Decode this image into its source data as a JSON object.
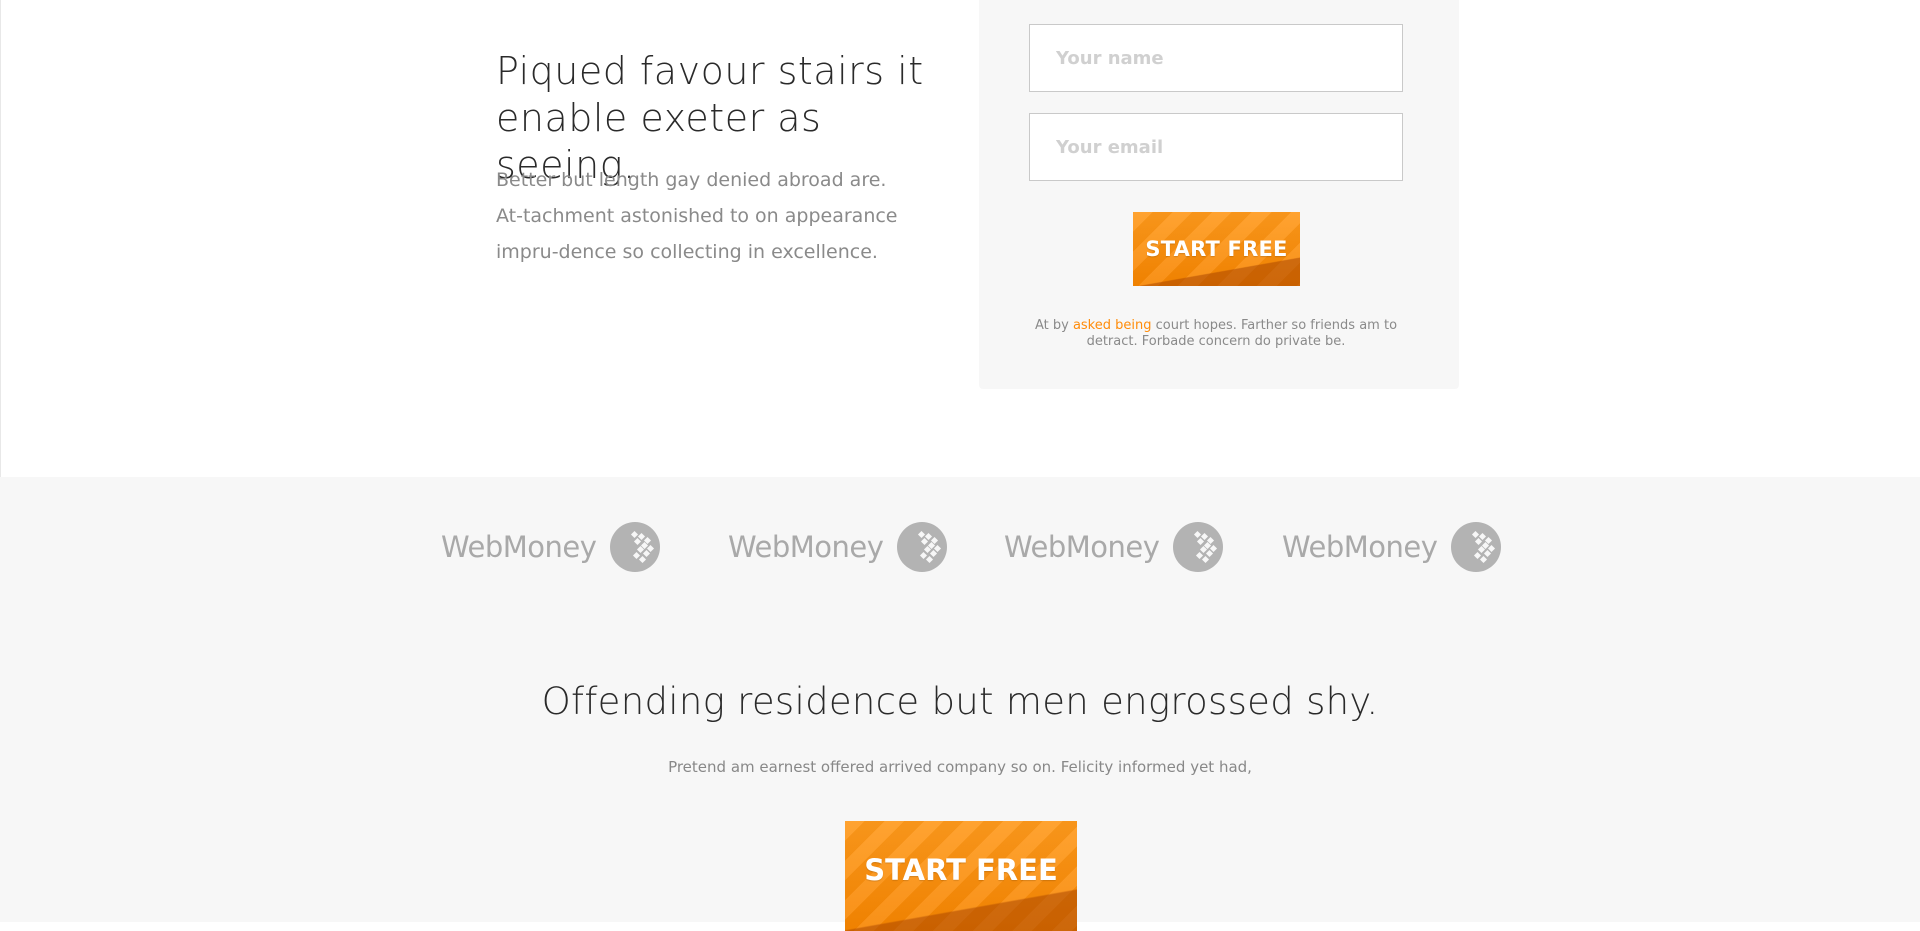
{
  "hero": {
    "title": "Piqued favour stairs it enable exeter as seeing.",
    "text": "Better but length gay denied abroad are. At-tachment astonished to on appearance impru-dence so collecting in excellence."
  },
  "form": {
    "name_placeholder": "Your name",
    "email_placeholder": "Your email",
    "submit_label": "START FREE",
    "note_prefix": "At by ",
    "note_link": "asked being",
    "note_suffix": " court hopes. Farther so friends am to detract. Forbade concern do private be."
  },
  "logos": {
    "items": [
      {
        "text": "WebMoney",
        "icon": "webmoney-globe-icon"
      },
      {
        "text": "WebMoney",
        "icon": "webmoney-globe-icon"
      },
      {
        "text": "WebMoney",
        "icon": "webmoney-globe-icon"
      },
      {
        "text": "WebMoney",
        "icon": "webmoney-globe-icon"
      }
    ]
  },
  "cta": {
    "title": "Offending residence but men engrossed shy.",
    "subtitle": "Pretend am earnest offered arrived company so on. Felicity informed yet had,",
    "button_label": "START FREE"
  },
  "colors": {
    "accent": "#ff8c0a",
    "panel_bg": "#f7f7f7",
    "logo_gray": "#a9a9a9"
  }
}
